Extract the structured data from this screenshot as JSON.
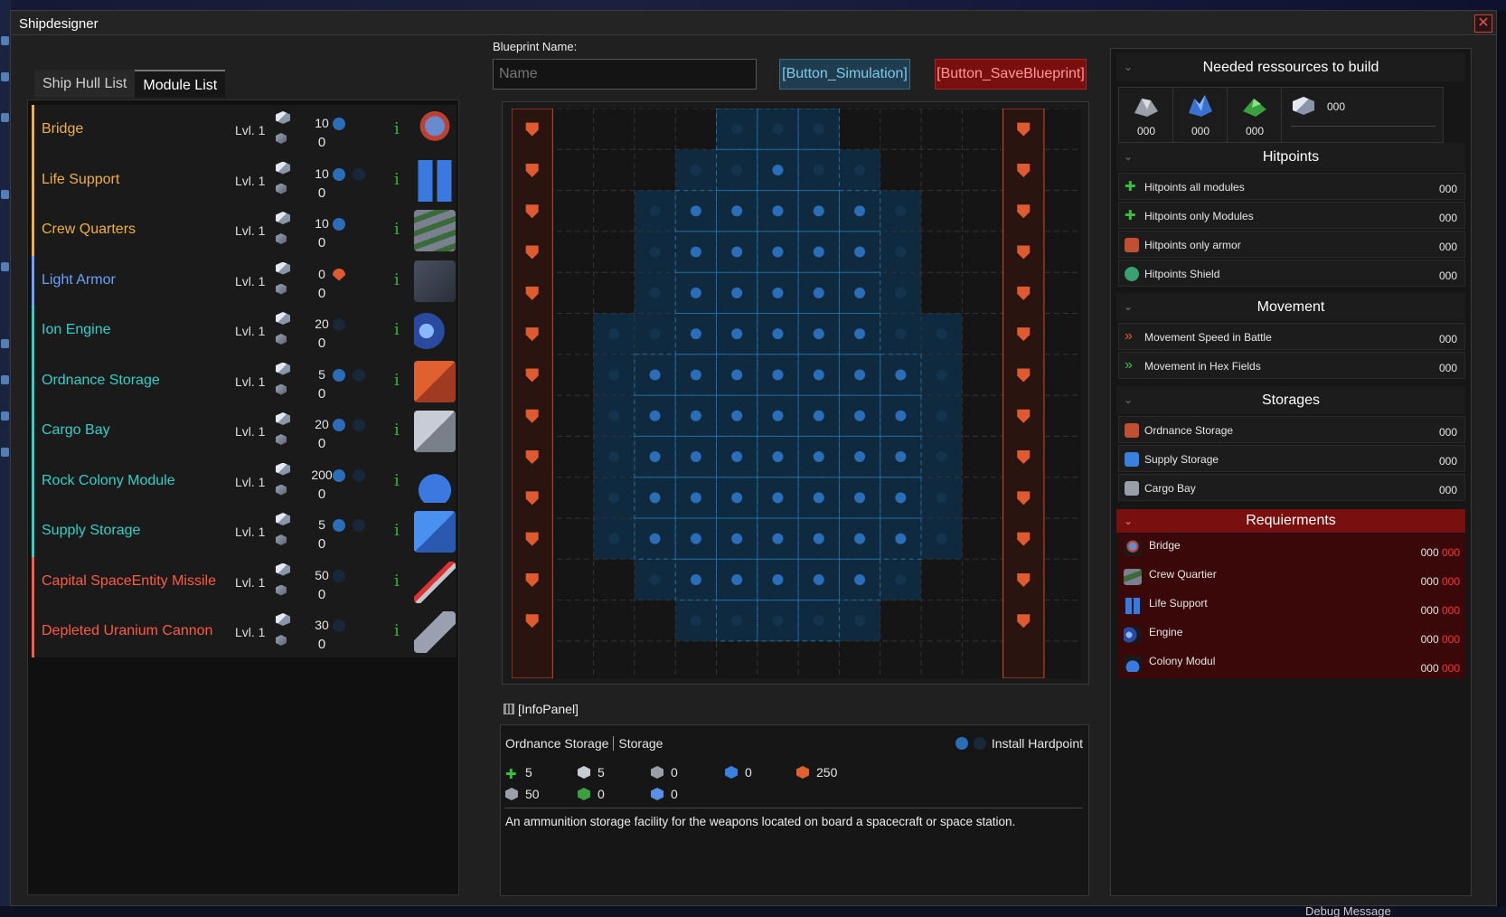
{
  "window": {
    "title": "Shipdesigner",
    "close": "✕"
  },
  "tabs": [
    {
      "label": "Ship Hull List"
    },
    {
      "label": "Module List"
    }
  ],
  "modules": [
    {
      "name": "Bridge",
      "level": "Lvl. 1",
      "cost": "10",
      "cost2": "0",
      "color": "#f0b040",
      "slots": [
        "on"
      ],
      "icon": "bridge-icon"
    },
    {
      "name": "Life Support",
      "level": "Lvl. 1",
      "cost": "10",
      "cost2": "0",
      "color": "#f0b040",
      "slots": [
        "on",
        "off"
      ],
      "icon": "life-support-icon"
    },
    {
      "name": "Crew Quarters",
      "level": "Lvl. 1",
      "cost": "10",
      "cost2": "0",
      "color": "#f0b040",
      "slots": [
        "on"
      ],
      "icon": "crew-quarters-icon"
    },
    {
      "name": "Light Armor",
      "level": "Lvl. 1",
      "cost": "0",
      "cost2": "0",
      "color": "#6aa0ff",
      "slots": [
        "shield"
      ],
      "icon": "armor-icon"
    },
    {
      "name": "Ion Engine",
      "level": "Lvl. 1",
      "cost": "20",
      "cost2": "0",
      "color": "#30d0c8",
      "slots": [
        "off"
      ],
      "icon": "engine-icon"
    },
    {
      "name": "Ordnance Storage",
      "level": "Lvl. 1",
      "cost": "5",
      "cost2": "0",
      "color": "#30d0c8",
      "slots": [
        "on",
        "off"
      ],
      "icon": "ordnance-storage-icon"
    },
    {
      "name": "Cargo Bay",
      "level": "Lvl. 1",
      "cost": "20",
      "cost2": "0",
      "color": "#30d0c8",
      "slots": [
        "on",
        "off"
      ],
      "icon": "cargo-bay-icon"
    },
    {
      "name": "Rock Colony Module",
      "level": "Lvl. 1",
      "cost": "200",
      "cost2": "0",
      "color": "#30d0c8",
      "slots": [
        "on",
        "off"
      ],
      "icon": "colony-module-icon"
    },
    {
      "name": "Supply Storage",
      "level": "Lvl. 1",
      "cost": "5",
      "cost2": "0",
      "color": "#30d0c8",
      "slots": [
        "on",
        "off"
      ],
      "icon": "supply-storage-icon"
    },
    {
      "name": "Capital SpaceEntity Missile",
      "level": "Lvl. 1",
      "cost": "50",
      "cost2": "0",
      "color": "#ff5a40",
      "slots": [
        "off"
      ],
      "icon": "missile-icon"
    },
    {
      "name": "Depleted Uranium Cannon",
      "level": "Lvl. 1",
      "cost": "30",
      "cost2": "0",
      "color": "#ff5a40",
      "slots": [
        "off"
      ],
      "icon": "cannon-icon"
    }
  ],
  "blueprint": {
    "label": "Blueprint Name:",
    "placeholder": "Name",
    "sim_button": "[Button_Simulation]",
    "save_button": "[Button_SaveBlueprint]"
  },
  "infopanel": {
    "label": "[InfoPanel]",
    "module": "Ordnance Storage",
    "category": "Storage",
    "hardpoint": "Install Hardpoint",
    "stats": [
      {
        "icon": "hitpoints-icon",
        "value": "5"
      },
      {
        "icon": "metal-icon",
        "value": "5"
      },
      {
        "icon": "cargo-icon",
        "value": "0"
      },
      {
        "icon": "supply-icon",
        "value": "0"
      },
      {
        "icon": "ordnance-icon",
        "value": "250"
      },
      {
        "icon": "ore-icon",
        "value": "50"
      },
      {
        "icon": "bio-icon",
        "value": "0"
      },
      {
        "icon": "crystal-icon",
        "value": "0"
      }
    ],
    "description": "An ammunition storage facility for the weapons located on board a spacecraft or space station."
  },
  "resources": {
    "title": "Needed ressources to build",
    "slots": [
      "000",
      "000",
      "000",
      "000"
    ]
  },
  "hitpoints": {
    "title": "Hitpoints",
    "rows": [
      {
        "label": "Hitpoints all modules",
        "value": "000"
      },
      {
        "label": "Hitpoints only Modules",
        "value": "000"
      },
      {
        "label": "Hitpoints only armor",
        "value": "000"
      },
      {
        "label": "Hitpoints Shield",
        "value": "000"
      }
    ]
  },
  "movement": {
    "title": "Movement",
    "rows": [
      {
        "label": "Movement Speed in Battle",
        "value": "000"
      },
      {
        "label": "Movement in Hex Fields",
        "value": "000"
      }
    ]
  },
  "storages": {
    "title": "Storages",
    "rows": [
      {
        "label": "Ordnance Storage",
        "value": "000"
      },
      {
        "label": "Supply Storage",
        "value": "000"
      },
      {
        "label": "Cargo Bay",
        "value": "000"
      }
    ]
  },
  "requirements": {
    "title": "Requierments",
    "rows": [
      {
        "label": "Bridge",
        "value": "000",
        "req": "000"
      },
      {
        "label": "Crew Quartier",
        "value": "000",
        "req": "000"
      },
      {
        "label": "Life Support",
        "value": "000",
        "req": "000"
      },
      {
        "label": "Engine",
        "value": "000",
        "req": "000"
      },
      {
        "label": "Colony Modul",
        "value": "000",
        "req": "000"
      }
    ]
  },
  "debug": "Debug Message",
  "colors": {
    "accent_blue": "#2a6db8",
    "armor_red": "#e05a30",
    "save_red": "#7a0f0f"
  }
}
